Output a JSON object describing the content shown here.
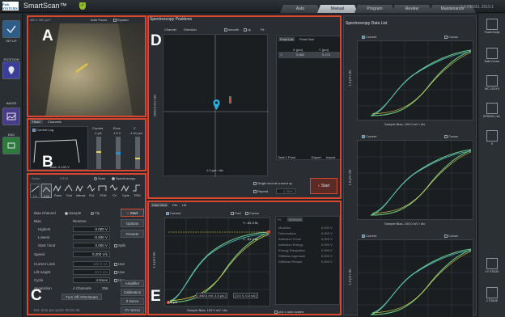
{
  "app": {
    "logo": "Park SYSTEMS",
    "title": "SmartScan™",
    "shield": "✓",
    "version": "1.1 DEVEL 2019.1"
  },
  "tabs": [
    "Auto",
    "Manual",
    "Program",
    "Review",
    "Maintenance"
  ],
  "active_tab": "Manual",
  "left_nav": [
    {
      "label": "SETUP"
    },
    {
      "label": "POSITION"
    },
    {
      "label": "IMAGE"
    },
    {
      "label": "END"
    }
  ],
  "camera": {
    "size": "480 x 360 µm²",
    "autofocus": "Auto Focus",
    "expand": "Expand",
    "label": "A"
  },
  "monitor": {
    "tabs": [
      "Head",
      "Channels"
    ],
    "log": "Current Log",
    "current_label": "Current",
    "current_val": "-1 pA",
    "error_label": "Error",
    "error_val": "1.0 V",
    "z_label": "Z",
    "z_val": "-1.41 µm",
    "bias": "Bias: 0.100 V",
    "label": "B"
  },
  "control": {
    "tabs": [
      "Setup",
      "SICM"
    ],
    "scan": "Scan",
    "spectroscopy": "Spectroscopy",
    "modes": [
      "I-V",
      "d-I/d",
      "Pulse",
      "Fwd",
      "Interval",
      "PUL",
      "PCM",
      "CV",
      "Cycle",
      "TRIG"
    ],
    "bias_channel_label": "Bias Channel",
    "bias_channel_sample": "Sample",
    "bias_channel_tip": "Tip",
    "bias_label": "Bias",
    "bias_mode": "Reverse",
    "rows": [
      {
        "label": "Highest",
        "val": "0.000 V"
      },
      {
        "label": "Lowest",
        "val": "-0.500 V"
      },
      {
        "label": "Start / End",
        "val": "0.000 V"
      }
    ],
    "split": "Split",
    "speed_label": "Speed",
    "speed_val": "0.200 V/s",
    "current_limit": "Current Limit",
    "current_limit_val": "100.0 nA",
    "use": "Use",
    "lift_height": "Lift Height",
    "lift_val": "10.0 nm",
    "cycle_label": "Cycle",
    "cycle_val": "4 times",
    "acq_label": "Acquisition",
    "acq_val": "4 Channels",
    "acq_num": "256",
    "turnoff": "Turn Off AFM Beam",
    "est": "Est. time per point: 00:01:36",
    "side": [
      "Start",
      "Options",
      "Presets",
      "Amplifier",
      "Calibration",
      "Z Servo",
      "XY Servo"
    ],
    "label": "C"
  },
  "positions": {
    "title": "Spectroscopy Positions",
    "tabs": [
      "Channel",
      "Direction"
    ],
    "smooth": "smooth",
    "xy": "xy",
    "fit": "Fit",
    "list_tabs": [
      "Point List",
      "Point Grid"
    ],
    "col_x": "X (µm)",
    "col_y": "Y (µm)",
    "row": {
      "idx": "1",
      "x": "0.562",
      "y": "0.173"
    },
    "xlabel": "1.0 µm / div",
    "ylabel": "1000.0 nm / div",
    "total": "Total 1 Point",
    "export": "Export",
    "import": "Import",
    "single": "Single shot at current xy",
    "repeat": "Repeat",
    "repeat_val": "1 time",
    "start": "Start",
    "label": "D"
  },
  "dataview": {
    "tabs": [
      "Data View",
      "File",
      "Lift"
    ],
    "channel": "Current",
    "fwd": "Fwd",
    "cursor": "Cursor",
    "cursor_y1": "Y: -51.3 fA",
    "cursor_y2": "Y: -51.3 fA",
    "ylabel": "1.0 pA / div",
    "ymin": "-4.6 pA",
    "xlabel": "Sample Bias, 100.0 mV / div",
    "marker1": "[ 480.5 mV, 4.5 pA ]",
    "marker2": "[ 0.0 V, 0.0 nA ]",
    "auto": "plot x auto scaled",
    "props_tabs": [
      "Fit",
      "Methods"
    ],
    "props": [
      {
        "k": "Modulus",
        "v": "0.000 V"
      },
      {
        "k": "Deformation",
        "v": "0.000 V"
      },
      {
        "k": "Adhesion Force",
        "v": "0.000 V"
      },
      {
        "k": "Adhesion Energy",
        "v": "0.000 V"
      },
      {
        "k": "Energy Dissipation",
        "v": "0.000 V"
      },
      {
        "k": "Stiffness Approach",
        "v": "0.000 V"
      },
      {
        "k": "Stiffness Retract",
        "v": "0.000 V"
      }
    ],
    "label": "E"
  },
  "datalist": {
    "title": "Spectroscopy Data List",
    "plots": [
      {
        "channel": "Current",
        "cursor": "Cursor",
        "ylabel": "1.0 pA / div",
        "xlabel": "Sample Bias, 100.0 mV / div"
      },
      {
        "channel": "Current",
        "cursor": "Cursor",
        "ylabel": "1.0 pA / div",
        "xlabel": "Sample Bias, 100.0 mV / div"
      },
      {
        "channel": "Current",
        "cursor": "Cursor",
        "ylabel": "1.0 pA / div",
        "xlabel": "Sample Bias, 100.0 mV / div"
      }
    ]
  },
  "right_tools": [
    {
      "label": "PowerScript"
    },
    {
      "label": "Data Cursor"
    },
    {
      "label": "MC XXXXX"
    },
    {
      "label": "SPRING CAL."
    },
    {
      "label": "K"
    },
    {
      "label": "XY STAGE"
    },
    {
      "label": "Z STAGE"
    }
  ],
  "colors": {
    "highlight": "#d9472f",
    "curve_green": "#6fcf8a",
    "curve_cyan": "#4fc3c9",
    "curve_yellow": "#e6d94a",
    "accent": "#2a8fd8"
  }
}
